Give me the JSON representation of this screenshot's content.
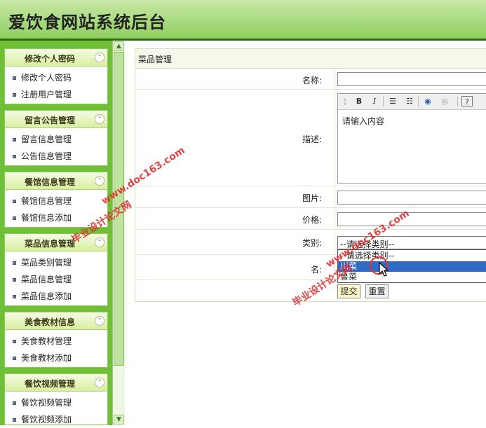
{
  "header": {
    "title": "爱饮食网站系统后台"
  },
  "sidebar": {
    "panels": [
      {
        "title": "修改个人密码",
        "items": [
          "修改个人密码",
          "注册用户管理"
        ]
      },
      {
        "title": "留言公告管理",
        "items": [
          "留言信息管理",
          "公告信息管理"
        ]
      },
      {
        "title": "餐馆信息管理",
        "items": [
          "餐馆信息管理",
          "餐馆信息添加"
        ]
      },
      {
        "title": "菜品信息管理",
        "items": [
          "菜品类别管理",
          "菜品信息管理",
          "菜品信息添加"
        ]
      },
      {
        "title": "美食教材信息",
        "items": [
          "美食教材管理",
          "美食教材添加"
        ]
      },
      {
        "title": "餐饮视频管理",
        "items": [
          "餐饮视频管理",
          "餐饮视频添加"
        ]
      }
    ]
  },
  "main": {
    "title": "菜品管理",
    "form": {
      "name_label": "名称:",
      "desc_label": "描述:",
      "desc_value": "请输入内容",
      "image_label": "图片:",
      "price_label": "价格:",
      "category_label": "类别:",
      "category_selected": "--请选择类别--",
      "category_options": [
        "--请选择类别--",
        "川菜",
        "鲁菜"
      ],
      "highlighted_option": "川菜",
      "hidden_label_partial": "名:",
      "submit_label": "提交",
      "reset_label": "重置"
    },
    "editor_toolbar": {
      "bold": "B",
      "italic": "I"
    }
  },
  "watermarks": [
    "www.doc163.com",
    "毕业设计论文网"
  ]
}
